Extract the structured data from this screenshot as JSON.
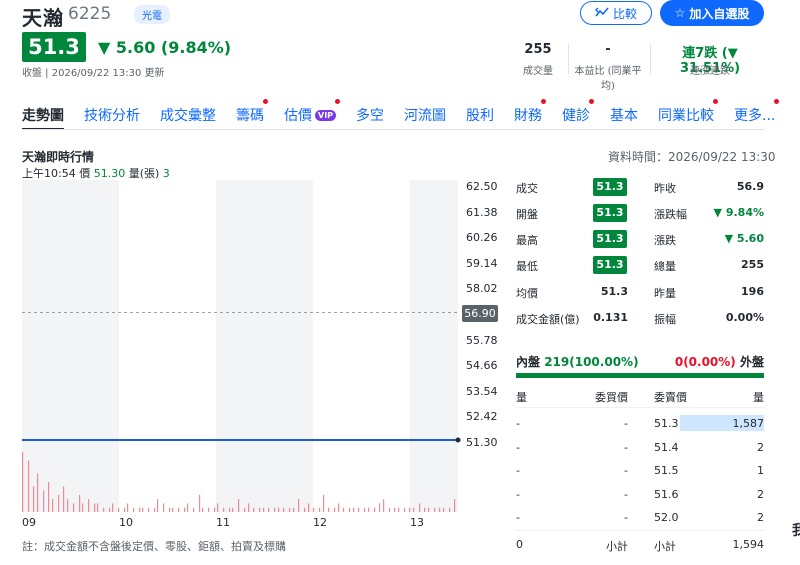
{
  "header": {
    "name": "天瀚",
    "code": "6225",
    "tag": "光電",
    "price": "51.3",
    "change": "▼ 5.60 (9.84%)",
    "close_time": "收盤 | 2026/09/22 13:30 更新",
    "follow_label": "比較",
    "add_label": "加入自選股"
  },
  "stats": [
    {
      "value": "255",
      "label": "成交量"
    },
    {
      "value": "-",
      "label": "本益比 (同業平均)"
    },
    {
      "value": "連7跌 (▼ 31.51%)",
      "label": "連漲連跌"
    }
  ],
  "tabs": [
    {
      "label": "走勢圖",
      "active": true,
      "dot": false,
      "vip": false
    },
    {
      "label": "技術分析",
      "dot": false
    },
    {
      "label": "成交彙整",
      "dot": false
    },
    {
      "label": "籌碼",
      "dot": true
    },
    {
      "label": "估價",
      "dot": true,
      "vip": true
    },
    {
      "label": "多空",
      "dot": false
    },
    {
      "label": "河流圖",
      "dot": false
    },
    {
      "label": "股利",
      "dot": false
    },
    {
      "label": "財務",
      "dot": true
    },
    {
      "label": "健診",
      "dot": true
    },
    {
      "label": "基本",
      "dot": false
    },
    {
      "label": "同業比較",
      "dot": true
    },
    {
      "label": "更多...",
      "dot": true
    }
  ],
  "vip_label": "VIP",
  "chart": {
    "title": "天瀚即時行情",
    "data_time": "資料時間：2026/09/22 13:30",
    "rt_time": "上午10:54",
    "rt_price_label": "價",
    "rt_price": "51.30",
    "rt_vol_label": "量(張)",
    "rt_vol": "3",
    "yticks": [
      "62.50",
      "61.38",
      "60.26",
      "59.14",
      "58.02",
      "56.90",
      "55.78",
      "54.66",
      "53.54",
      "52.42",
      "51.30"
    ],
    "xticks": [
      "09",
      "10",
      "11",
      "12",
      "13"
    ],
    "ref_price": "56.90",
    "note": "註：成交金額不含盤後定價、零股、鉅額、拍賣及標購"
  },
  "chart_data": {
    "type": "line",
    "title": "天瀚即時行情",
    "ylim": [
      51.3,
      62.5
    ],
    "x_range": [
      "09:00",
      "13:30"
    ],
    "reference_price": 56.9,
    "series": [
      {
        "values": [
          51.3,
          51.3,
          51.3,
          51.3,
          51.3
        ]
      }
    ],
    "volume_bars": [
      14,
      12,
      6,
      9,
      5,
      7,
      3,
      4,
      6,
      3,
      2,
      4,
      2,
      3,
      2,
      2,
      1,
      1,
      2,
      1,
      1,
      2,
      1,
      1,
      1,
      1,
      1,
      3,
      2,
      1,
      1,
      1,
      1,
      2,
      1,
      4,
      1,
      1,
      1,
      2,
      1,
      1,
      1,
      3,
      1,
      2,
      1,
      1,
      1,
      1,
      1,
      1,
      1,
      1,
      1,
      3,
      1,
      2,
      1,
      1,
      4,
      1,
      1,
      2,
      1,
      1,
      1,
      1,
      1,
      1,
      1,
      2,
      3,
      1,
      1,
      1,
      1,
      1,
      1,
      2,
      1,
      1,
      1,
      1,
      1,
      1,
      3
    ],
    "colors": {
      "price_line": "#1f5bd6",
      "volume": "#eb0f29"
    }
  },
  "quote": {
    "left": [
      {
        "label": "成交",
        "value": "51.3",
        "boxed": true
      },
      {
        "label": "開盤",
        "value": "51.3",
        "boxed": true
      },
      {
        "label": "最高",
        "value": "51.3",
        "boxed": true
      },
      {
        "label": "最低",
        "value": "51.3",
        "boxed": true
      },
      {
        "label": "均價",
        "value": "51.3"
      },
      {
        "label": "成交金額(億)",
        "value": "0.131"
      }
    ],
    "right": [
      {
        "label": "昨收",
        "value": "56.9",
        "color": "dark"
      },
      {
        "label": "漲跌幅",
        "value": "▼ 9.84%",
        "color": "green"
      },
      {
        "label": "漲跌",
        "value": "▼ 5.60",
        "color": "green"
      },
      {
        "label": "總量",
        "value": "255",
        "color": "dark"
      },
      {
        "label": "昨量",
        "value": "196",
        "color": "dark"
      },
      {
        "label": "振幅",
        "value": "0.00%",
        "color": "dark"
      }
    ]
  },
  "inout": {
    "inner_label": "內盤",
    "inner_value": "219(100.00%)",
    "outer_value": "0(0.00%)",
    "outer_label": "外盤"
  },
  "orderbook": {
    "headers": [
      "量",
      "委買價",
      "委賣價",
      "量"
    ],
    "rows": [
      {
        "bid_vol": "-",
        "bid": "-",
        "ask": "51.3",
        "ask_vol": "1,587"
      },
      {
        "bid_vol": "-",
        "bid": "-",
        "ask": "51.4",
        "ask_vol": "2"
      },
      {
        "bid_vol": "-",
        "bid": "-",
        "ask": "51.5",
        "ask_vol": "1"
      },
      {
        "bid_vol": "-",
        "bid": "-",
        "ask": "51.6",
        "ask_vol": "2"
      },
      {
        "bid_vol": "-",
        "bid": "-",
        "ask": "52.0",
        "ask_vol": "2"
      }
    ],
    "footer": {
      "bid_total": "0",
      "bid_label": "小計",
      "ask_label": "小計",
      "ask_total": "1,594"
    }
  },
  "edge_text": "我"
}
